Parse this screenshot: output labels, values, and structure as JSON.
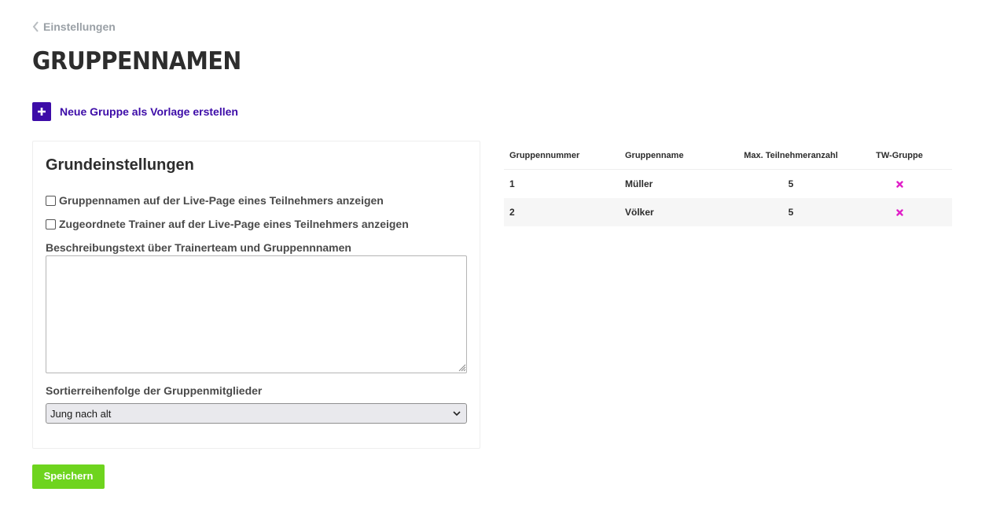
{
  "nav": {
    "back_label": "Einstellungen",
    "back_icon": "chevron-left-icon"
  },
  "page": {
    "title": "GRUPPENNAMEN"
  },
  "actions": {
    "new_group_label": "Neue Gruppe als Vorlage erstellen",
    "new_group_icon": "plus-icon",
    "accent": "#3d0ca8"
  },
  "settings": {
    "heading": "Grundeinstellungen",
    "checkbox_show_group_names": {
      "label": "Gruppennamen auf der Live-Page eines Teilnehmers anzeigen",
      "checked": false
    },
    "checkbox_show_trainers": {
      "label": "Zugeordnete Trainer auf der Live-Page eines Teilnehmers anzeigen",
      "checked": false
    },
    "description_label": "Beschreibungstext über Trainerteam und Gruppennnamen",
    "description_value": "",
    "sort_label": "Sortierreihenfolge der Gruppenmitglieder",
    "sort_selected": "Jung nach alt"
  },
  "save_button": {
    "label": "Speichern",
    "color": "#6ed41e"
  },
  "groups_table": {
    "headers": [
      "Gruppennummer",
      "Gruppenname",
      "Max. Teilnehmeranzahl",
      "TW-Gruppe"
    ],
    "rows": [
      {
        "number": "1",
        "name": "Müller",
        "max": "5",
        "tw_group": false
      },
      {
        "number": "2",
        "name": "Völker",
        "max": "5",
        "tw_group": false
      }
    ],
    "tw_false_icon": "cross-icon",
    "tw_false_color": "#e020c8"
  }
}
